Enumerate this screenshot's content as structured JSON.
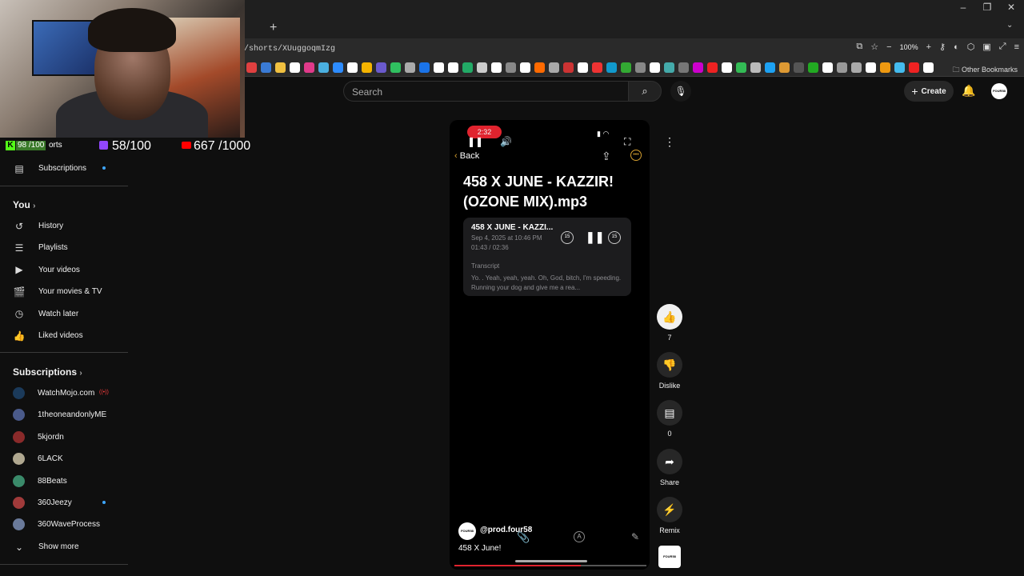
{
  "browser": {
    "url": "/shorts/XUuggoqmIzg",
    "zoom": "100%",
    "new_tab": "+",
    "other_bookmarks": "Other Bookmarks",
    "window_controls": [
      "–",
      "❐",
      "✕"
    ]
  },
  "stream_overlay": {
    "kick_value": "98 /100",
    "kick_suffix": "orts",
    "twitch_value": "58/100",
    "youtube_value": "667 /1000"
  },
  "header": {
    "search_placeholder": "Search",
    "create_label": "Create",
    "avatar_text": "FOUR58"
  },
  "sidebar": {
    "subscriptions_link": "Subscriptions",
    "you_heading": "You",
    "you_items": [
      {
        "label": "History",
        "icon": "history-icon"
      },
      {
        "label": "Playlists",
        "icon": "playlist-icon"
      },
      {
        "label": "Your videos",
        "icon": "your-videos-icon"
      },
      {
        "label": "Your movies & TV",
        "icon": "movies-icon"
      },
      {
        "label": "Watch later",
        "icon": "clock-icon"
      },
      {
        "label": "Liked videos",
        "icon": "thumbs-up-icon"
      }
    ],
    "subscriptions_heading": "Subscriptions",
    "channels": [
      {
        "name": "WatchMojo.com",
        "color": "#1b3a5a"
      },
      {
        "name": "1theoneandonlyME",
        "color": "#4a5a8a"
      },
      {
        "name": "5kjordn",
        "color": "#8a2a2a"
      },
      {
        "name": "6LACK",
        "color": "#b0a890"
      },
      {
        "name": "88Beats",
        "color": "#3a8a6a"
      },
      {
        "name": "360Jeezy",
        "color": "#a03a3a"
      },
      {
        "name": "360WaveProcess",
        "color": "#6a7a9a"
      }
    ],
    "show_more": "Show more"
  },
  "player": {
    "time_pill": "2:32",
    "back_label": "Back",
    "video_title": "458 X JUNE - KAZZIR! (OZONE MIX).mp3",
    "card": {
      "title": "458 X JUNE - KAZZI...",
      "date": "Sep 4, 2025 at 10:46 PM",
      "time": "01:43 / 02:36",
      "skip_back": "15",
      "skip_forward": "15",
      "transcript_label": "Transcript",
      "transcript_text": "Yo. . Yeah, yeah, yeah. Oh, God, bitch, I'm speeding. Running your dog and give me a rea..."
    },
    "channel": "@prod.four58",
    "channel_avatar": "FOUR58",
    "description": "458 X June!",
    "progress": 0.66
  },
  "actions": {
    "like_count": "7",
    "dislike_label": "Dislike",
    "comment_count": "0",
    "share_label": "Share",
    "remix_label": "Remix",
    "sound_avatar": "FOUR58"
  },
  "colors": {
    "accent_red": "#e0232e",
    "kick_green": "#53fc18",
    "twitch_purple": "#9146ff",
    "youtube_red": "#ff0000"
  }
}
